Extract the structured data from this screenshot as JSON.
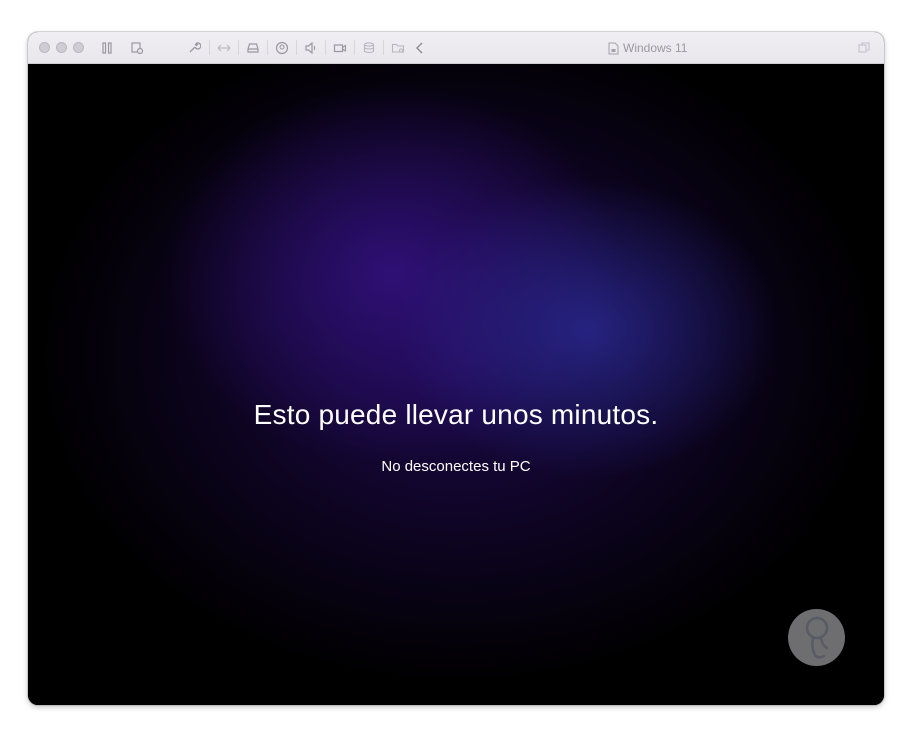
{
  "window": {
    "title": "Windows 11"
  },
  "toolbar": {
    "icons": [
      "pause-icon",
      "snapshot-icon",
      "settings-wrench-icon",
      "resize-icon",
      "disk-icon",
      "user-icon",
      "sound-icon",
      "camera-icon",
      "usb-icon",
      "shared-folder-icon",
      "back-chevron-icon",
      "fullscreen-icon"
    ]
  },
  "screen": {
    "headline": "Esto puede llevar unos minutos.",
    "subline": "No desconectes tu PC"
  },
  "colors": {
    "background": "#000000",
    "glow_purple": "#30107A",
    "glow_blue": "#28288C",
    "text": "#FFFFFF"
  }
}
